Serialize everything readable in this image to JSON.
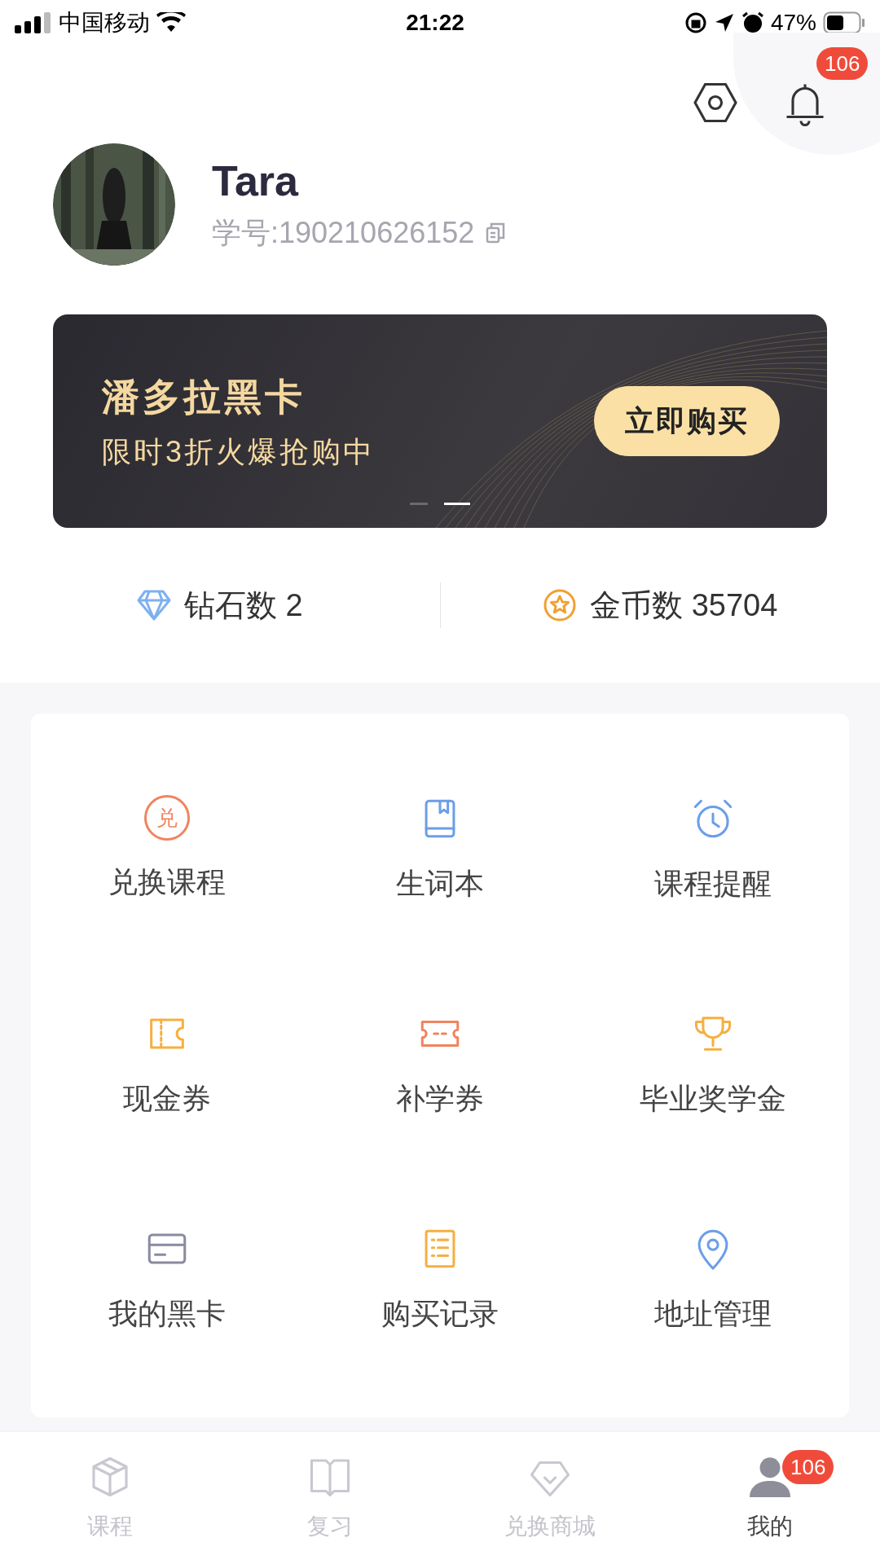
{
  "status_bar": {
    "carrier": "中国移动",
    "time": "21:22",
    "battery": "47%"
  },
  "header": {
    "notification_badge": "106"
  },
  "profile": {
    "name": "Tara",
    "student_id": "学号:190210626152"
  },
  "banner": {
    "title": "潘多拉黑卡",
    "subtitle": "限时3折火爆抢购中",
    "button": "立即购买",
    "pages": [
      {
        "selected": false
      },
      {
        "selected": true
      }
    ]
  },
  "stats": [
    {
      "kind": "diamond",
      "label": "钻石数 2"
    },
    {
      "kind": "coin",
      "label": "金币数 35704"
    }
  ],
  "menu": [
    {
      "kind": "redeem",
      "glyph": "兑",
      "label": "兑换课程"
    },
    {
      "kind": "wordbook",
      "label": "生词本"
    },
    {
      "kind": "alarm",
      "label": "课程提醒"
    },
    {
      "kind": "voucher",
      "label": "现金券"
    },
    {
      "kind": "ticket",
      "label": "补学券"
    },
    {
      "kind": "trophy",
      "label": "毕业奖学金"
    },
    {
      "kind": "card",
      "label": "我的黑卡"
    },
    {
      "kind": "list",
      "label": "购买记录"
    },
    {
      "kind": "pin",
      "label": "地址管理"
    }
  ],
  "tab_bar": [
    {
      "kind": "cube",
      "label": "课程",
      "selected": false
    },
    {
      "kind": "book",
      "label": "复习",
      "selected": false
    },
    {
      "kind": "gem",
      "label": "兑换商城",
      "selected": false
    },
    {
      "kind": "person",
      "label": "我的",
      "selected": true,
      "badge": "106"
    }
  ]
}
